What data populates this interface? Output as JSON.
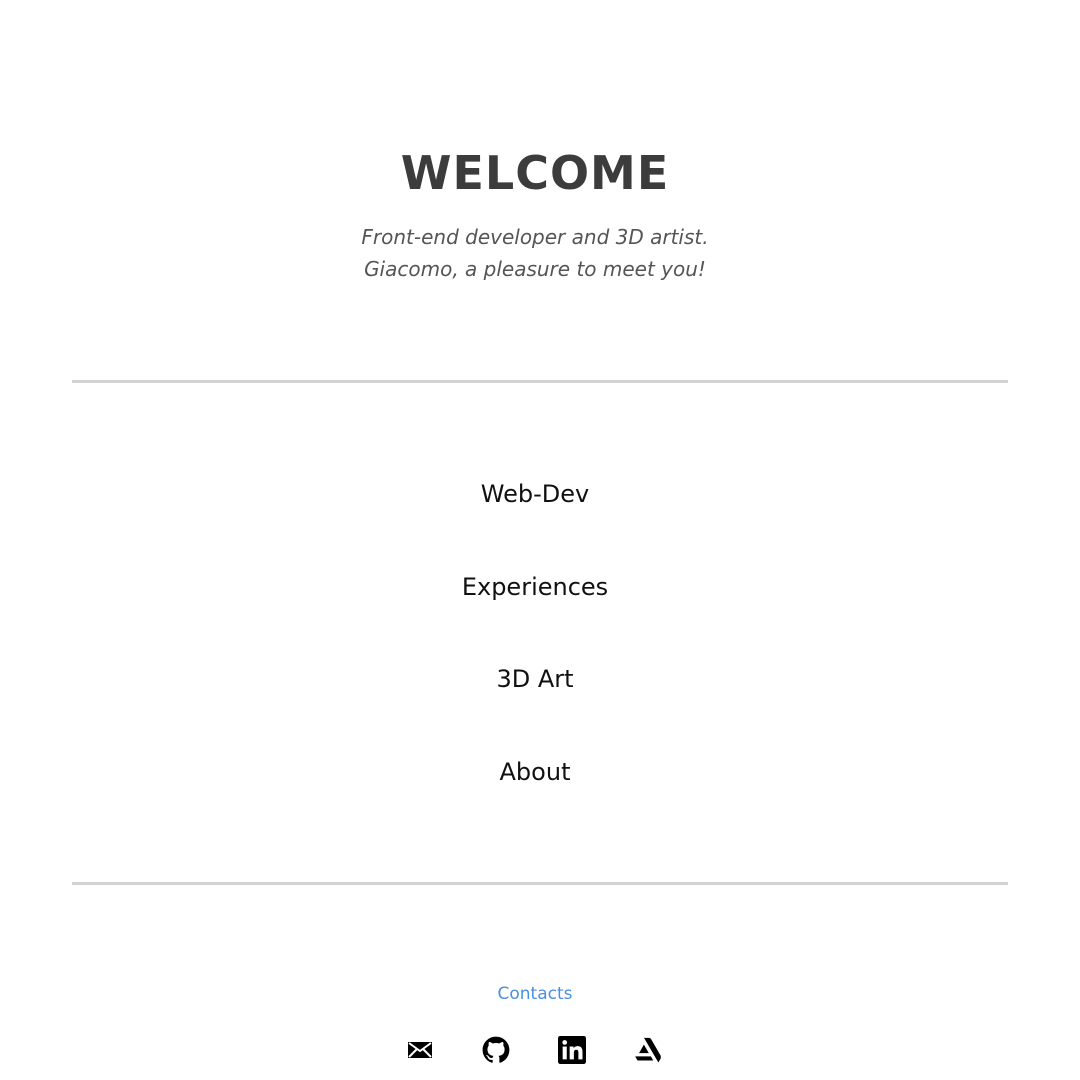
{
  "hero": {
    "title": "WELCOME",
    "subtitle_line1": "Front-end developer and 3D artist.",
    "subtitle_line2": "Giacomo, a pleasure to meet you!"
  },
  "nav": {
    "items": [
      {
        "label": "Web-Dev"
      },
      {
        "label": "Experiences"
      },
      {
        "label": "3D Art"
      },
      {
        "label": "About"
      }
    ]
  },
  "contacts": {
    "title": "Contacts",
    "icons": [
      "mail-icon",
      "github-icon",
      "linkedin-icon",
      "artstation-icon"
    ]
  },
  "colors": {
    "title": "#3c3c3c",
    "subtitle": "#555555",
    "divider": "#d2d2d2",
    "link": "#4a90e2",
    "nav_text": "#111111"
  }
}
